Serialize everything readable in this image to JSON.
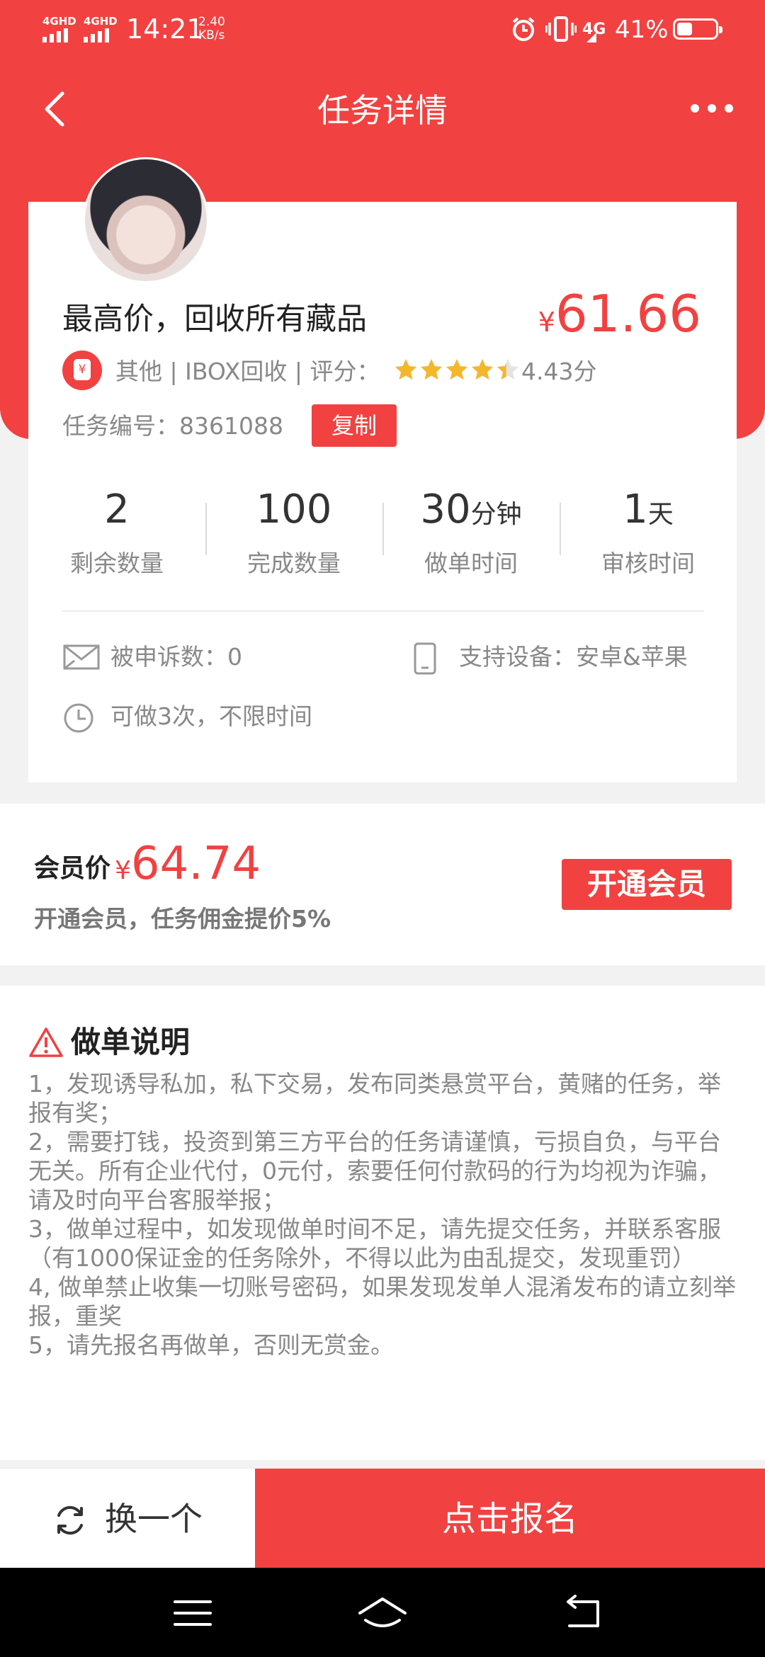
{
  "status_bar": {
    "signal1": "4GHD",
    "signal2": "4GHD",
    "time": "14:21",
    "speed_value": "2.40",
    "speed_unit": "KB/s",
    "network": "4G",
    "battery": "41%",
    "battery_level": 0.41
  },
  "nav": {
    "title": "任务详情"
  },
  "task": {
    "title": "最高价，回收所有藏品",
    "currency": "¥",
    "price": "61.66",
    "meta": "其他 | IBOX回收 | 评分：",
    "rating_stars": 4.43,
    "rating_text": "4.43分",
    "task_no_label": "任务编号：8361088",
    "copy_label": "复制"
  },
  "stats": [
    {
      "value": "2",
      "unit": "",
      "label": "剩余数量"
    },
    {
      "value": "100",
      "unit": "",
      "label": "完成数量"
    },
    {
      "value": "30",
      "unit": "分钟",
      "label": "做单时间"
    },
    {
      "value": "1",
      "unit": "天",
      "label": "审核时间"
    }
  ],
  "info": {
    "complaints": "被申诉数：0",
    "devices": "支持设备：安卓&苹果",
    "limit": "可做3次，不限时间"
  },
  "member": {
    "label": "会员价",
    "currency": "¥",
    "price": "64.74",
    "sub": "开通会员，任务佣金提价5%",
    "join_label": "开通会员"
  },
  "instructions": {
    "title": "做单说明",
    "lines": [
      "1，发现诱导私加，私下交易，发布同类悬赏平台，黄赌的任务，举报有奖；",
      "2，需要打钱，投资到第三方平台的任务请谨慎，亏损自负，与平台无关。所有企业代付，0元付，索要任何付款码的行为均视为诈骗，请及时向平台客服举报；",
      "3，做单过程中，如发现做单时间不足，请先提交任务，并联系客服（有1000保证金的任务除外，不得以此为由乱提交，发现重罚）",
      "4, 做单禁止收集一切账号密码，如果发现发单人混淆发布的请立刻举报，重奖",
      "5，请先报名再做单，否则无赏金。"
    ]
  },
  "bottom": {
    "swap_label": "换一个",
    "signup_label": "点击报名"
  },
  "colors": {
    "accent": "#f24141",
    "star": "#f5b72a"
  }
}
